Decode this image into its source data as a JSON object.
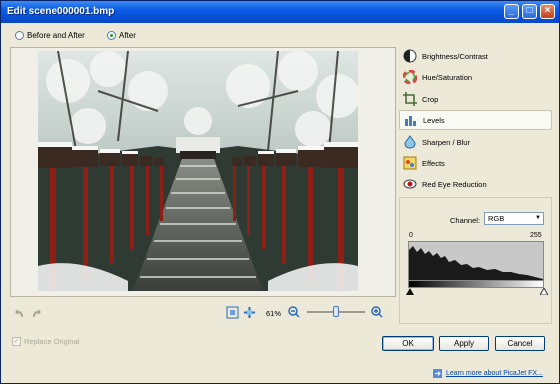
{
  "window": {
    "title": "Edit scene000001.bmp",
    "controls": {
      "minimize": "_",
      "maximize": "□",
      "close": "×"
    }
  },
  "view_mode": {
    "options": [
      "Before and After",
      "After"
    ],
    "selected": "After"
  },
  "preview": {
    "image_description": "snowy stone stairway lined with red lanterns"
  },
  "zoom": {
    "label": "61%",
    "slider_fraction": 0.5
  },
  "tools": [
    {
      "label": "Brightness/Contrast",
      "icon": "brightness-contrast-icon"
    },
    {
      "label": "Hue/Saturation",
      "icon": "hue-saturation-icon"
    },
    {
      "label": "Crop",
      "icon": "crop-icon"
    },
    {
      "label": "Levels",
      "icon": "levels-icon",
      "active": true
    },
    {
      "label": "Sharpen / Blur",
      "icon": "sharpen-blur-icon"
    },
    {
      "label": "Effects",
      "icon": "effects-icon"
    },
    {
      "label": "Red Eye Reduction",
      "icon": "red-eye-icon"
    }
  ],
  "levels": {
    "channel_label": "Channel:",
    "channel_value": "RGB",
    "min": "0",
    "max": "255"
  },
  "replace_original": {
    "label": "Replace Original",
    "checked": true,
    "enabled": false
  },
  "buttons": {
    "ok": "OK",
    "apply": "Apply",
    "cancel": "Cancel"
  },
  "footer": {
    "link": "Learn more about PicaJet FX..."
  }
}
